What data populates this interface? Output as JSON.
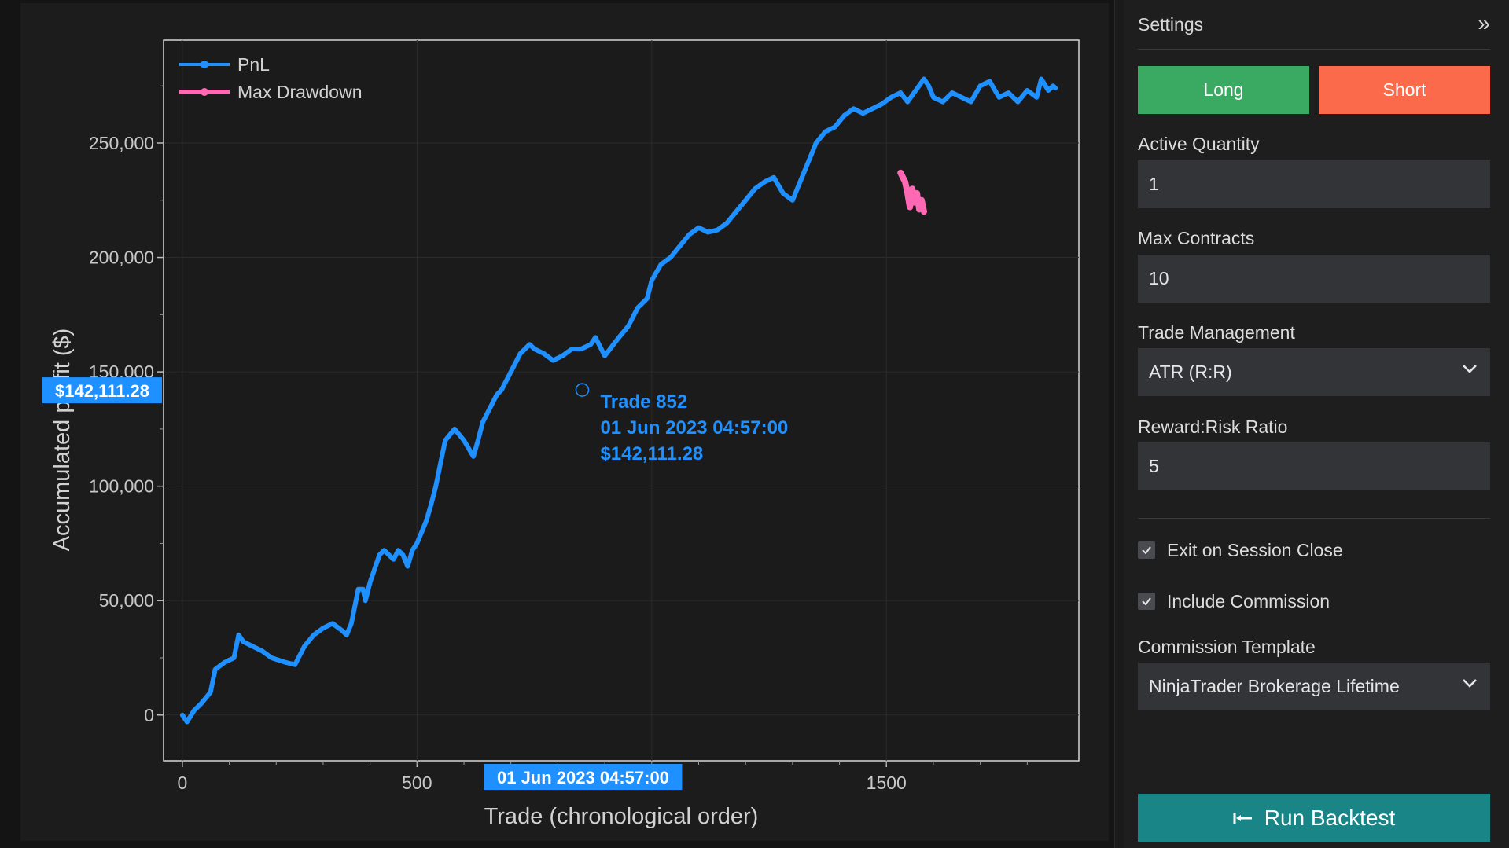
{
  "chart": {
    "legend": [
      {
        "name": "PnL",
        "color": "#1e90ff"
      },
      {
        "name": "Max Drawdown",
        "color": "#ff69b4"
      }
    ],
    "xlabel": "Trade (chronological order)",
    "ylabel": "Accumulated profit ($)",
    "crosshair": {
      "y_badge": "$142,111.28",
      "x_badge": "01 Jun 2023 04:57:00",
      "tooltip": [
        "Trade 852",
        "01 Jun 2023 04:57:00",
        "$142,111.28"
      ],
      "trade": 852,
      "value": 142111.28
    }
  },
  "chart_data": {
    "type": "line",
    "xlabel": "Trade (chronological order)",
    "ylabel": "Accumulated profit ($)",
    "xlim": [
      -40,
      1910
    ],
    "ylim": [
      -20000,
      295000
    ],
    "xticks": [
      0,
      500,
      1500
    ],
    "xtick_labels": [
      "0",
      "500",
      "1500"
    ],
    "yticks": [
      0,
      50000,
      100000,
      150000,
      200000,
      250000
    ],
    "ytick_labels": [
      "0",
      "50,000",
      "100,000",
      "150,000",
      "200,000",
      "250,000"
    ],
    "grid": true,
    "legend_position": "top-left",
    "series": [
      {
        "name": "PnL",
        "color": "#1e90ff",
        "x": [
          0,
          10,
          25,
          40,
          60,
          70,
          90,
          110,
          120,
          130,
          150,
          170,
          190,
          220,
          240,
          260,
          280,
          300,
          320,
          340,
          350,
          360,
          370,
          375,
          385,
          390,
          400,
          420,
          430,
          440,
          450,
          460,
          470,
          480,
          490,
          500,
          510,
          520,
          530,
          540,
          560,
          580,
          600,
          620,
          630,
          640,
          660,
          670,
          680,
          700,
          720,
          740,
          750,
          770,
          790,
          810,
          830,
          850,
          870,
          880,
          900,
          930,
          950,
          970,
          990,
          1000,
          1020,
          1040,
          1060,
          1080,
          1100,
          1120,
          1140,
          1160,
          1180,
          1200,
          1220,
          1240,
          1260,
          1280,
          1300,
          1320,
          1340,
          1350,
          1370,
          1390,
          1410,
          1430,
          1450,
          1470,
          1490,
          1510,
          1530,
          1545,
          1580,
          1590,
          1600,
          1620,
          1640,
          1660,
          1680,
          1700,
          1720,
          1740,
          1760,
          1780,
          1800,
          1820,
          1830,
          1845,
          1855,
          1860
        ],
        "y": [
          0,
          -3000,
          2000,
          5000,
          10000,
          20000,
          23000,
          25000,
          35000,
          32000,
          30000,
          28000,
          25000,
          23000,
          22000,
          30000,
          35000,
          38000,
          40000,
          37000,
          35000,
          40000,
          50000,
          55000,
          55000,
          50000,
          58000,
          70000,
          72000,
          70000,
          68000,
          72000,
          70000,
          65000,
          72000,
          75000,
          80000,
          85000,
          92000,
          100000,
          120000,
          125000,
          120000,
          113000,
          120000,
          128000,
          136000,
          140000,
          142111,
          150000,
          158000,
          162000,
          160000,
          158000,
          155000,
          157000,
          160000,
          160000,
          162000,
          165000,
          157000,
          165000,
          170000,
          178000,
          182000,
          190000,
          197000,
          200000,
          205000,
          210000,
          213000,
          211000,
          212000,
          215000,
          220000,
          225000,
          230000,
          233000,
          235000,
          228000,
          225000,
          235000,
          245000,
          250000,
          255000,
          257000,
          262000,
          265000,
          263000,
          265000,
          267000,
          270000,
          272000,
          268000,
          278000,
          275000,
          270000,
          268000,
          272000,
          270000,
          268000,
          275000,
          277000,
          270000,
          272000,
          268000,
          273000,
          270000,
          278000,
          273000,
          275000,
          274000
        ]
      },
      {
        "name": "Max Drawdown",
        "color": "#ff69b4",
        "x": [
          1530,
          1540,
          1545,
          1550,
          1555,
          1560,
          1565,
          1570,
          1575,
          1580
        ],
        "y": [
          237000,
          233000,
          228000,
          222000,
          230000,
          224000,
          228000,
          221000,
          225000,
          220000
        ]
      }
    ]
  },
  "settings": {
    "title": "Settings",
    "collapse_glyph": "»",
    "long_label": "Long",
    "short_label": "Short",
    "active_quantity": {
      "label": "Active Quantity",
      "value": "1"
    },
    "max_contracts": {
      "label": "Max Contracts",
      "value": "10"
    },
    "trade_management": {
      "label": "Trade Management",
      "value": "ATR (R:R)"
    },
    "reward_risk": {
      "label": "Reward:Risk Ratio",
      "value": "5"
    },
    "exit_session": {
      "label": "Exit on Session Close",
      "checked": true
    },
    "include_commission": {
      "label": "Include Commission",
      "checked": true
    },
    "commission_template": {
      "label": "Commission Template",
      "value": "NinjaTrader Brokerage Lifetime"
    },
    "run_label": "Run Backtest",
    "colors": {
      "long": "#3aaa63",
      "short": "#fb6a4a",
      "run": "#198587"
    }
  }
}
